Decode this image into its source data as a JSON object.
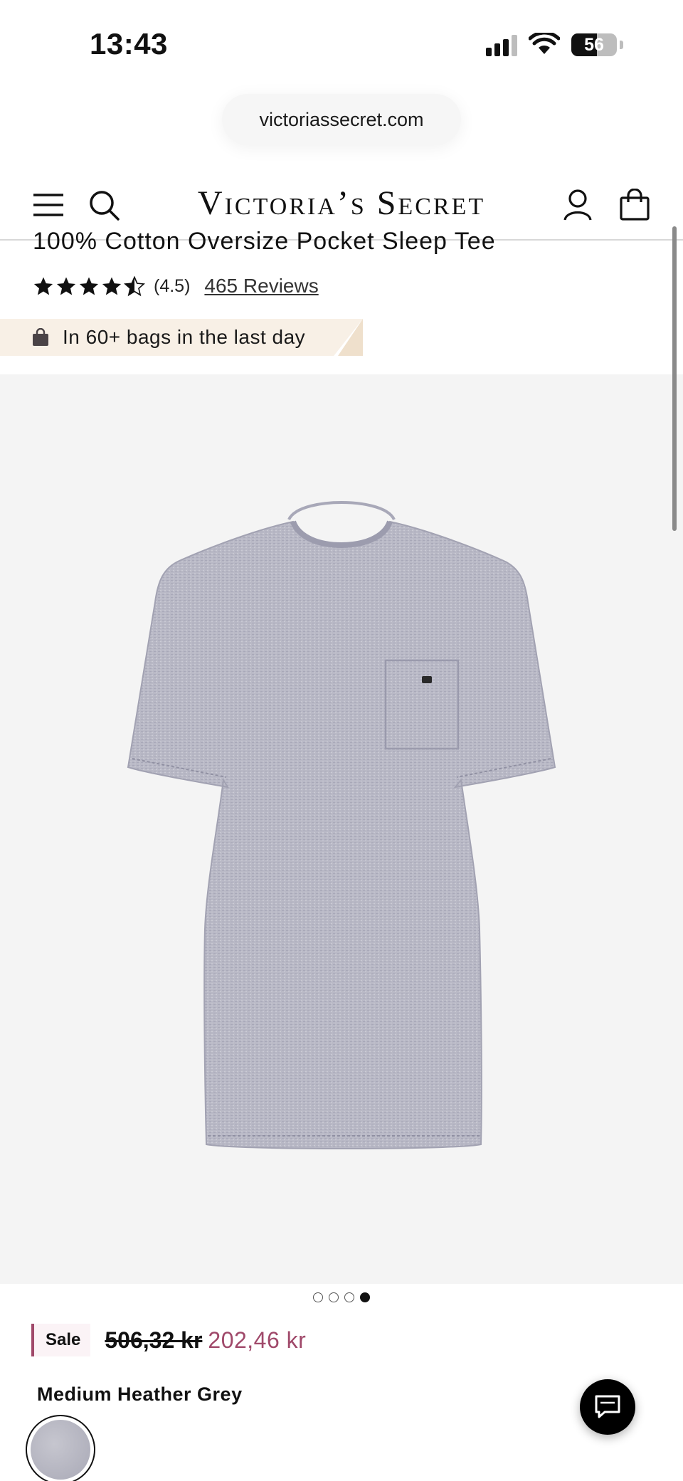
{
  "status_bar": {
    "time": "13:43",
    "battery_percent": "56",
    "battery_level": 0.56,
    "icons": [
      "cellular-signal-icon",
      "wifi-icon",
      "battery-icon"
    ]
  },
  "browser": {
    "url": "victoriassecret.com"
  },
  "header": {
    "logo": "Victoria’s Secret",
    "icons": [
      "menu-icon",
      "search-icon",
      "account-icon",
      "shopping-bag-icon"
    ]
  },
  "product": {
    "title": "100% Cotton Oversize Pocket Sleep Tee",
    "rating": "(4.5)",
    "rating_value": 4.5,
    "reviews_label": "465 Reviews",
    "popularity_banner": "In 60+ bags in the last day",
    "images": {
      "count": 4,
      "active_index": 3
    },
    "sale_label": "Sale",
    "original_price": "506,32 kr",
    "sale_price": "202,46 kr",
    "color_name": "Medium Heather Grey"
  },
  "colors": {
    "sale_accent": "#a0496a",
    "banner_background": "#f8f0e6",
    "image_background": "#f4f4f4"
  },
  "chat": {
    "icon": "chat-bubble-icon"
  }
}
